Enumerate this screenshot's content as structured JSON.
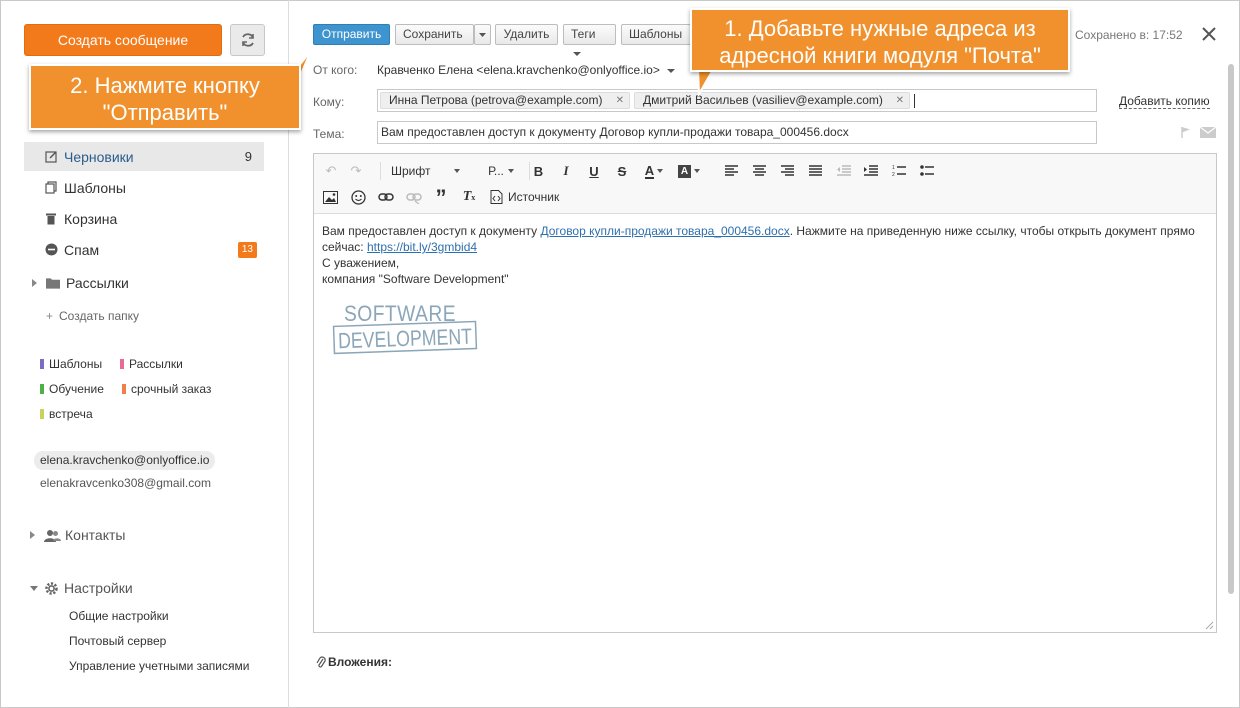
{
  "sidebar": {
    "create_label": "Создать сообщение",
    "folders": [
      {
        "label": "Черновики",
        "count": "9"
      },
      {
        "label": "Шаблоны"
      },
      {
        "label": "Корзина"
      },
      {
        "label": "Спам",
        "badge": "13"
      },
      {
        "label": "Рассылки"
      }
    ],
    "create_folder_label": "Создать папку",
    "tags": [
      {
        "label": "Шаблоны",
        "color": "#7b6cc4"
      },
      {
        "label": "Рассылки",
        "color": "#e96a90"
      },
      {
        "label": "Обучение",
        "color": "#4fb04a"
      },
      {
        "label": "срочный заказ",
        "color": "#f07f4a"
      },
      {
        "label": "встреча",
        "color": "#c9d35b"
      }
    ],
    "accounts": [
      "elena.kravchenko@onlyoffice.io",
      "elenakravcenko308@gmail.com"
    ],
    "contacts_label": "Контакты",
    "settings_label": "Настройки",
    "settings_items": [
      "Общие настройки",
      "Почтовый сервер",
      "Управление учетными записями"
    ]
  },
  "toolbar": {
    "send_label": "Отправить",
    "save_label": "Сохранить",
    "delete_label": "Удалить",
    "tags_label": "Теги",
    "templates_label": "Шаблоны",
    "saved_text": "Сохранено в: 17:52"
  },
  "compose": {
    "from_label": "От кого:",
    "from_value": "Кравченко Елена <elena.kravchenko@onlyoffice.io>",
    "to_label": "Кому:",
    "recipients": [
      "Инна Петрова (petrova@example.com)",
      "Дмитрий Васильев (vasiliev@example.com)"
    ],
    "add_copy_label": "Добавить копию",
    "subject_label": "Тема:",
    "subject_value": "Вам предоставлен доступ к документу Договор купли-продажи товара_000456.docx"
  },
  "editor": {
    "font_label": "Шрифт",
    "size_label": "Р...",
    "source_label": "Источник",
    "body_intro": "Вам предоставлен доступ к документу ",
    "body_link": "Договор купли-продажи товара_000456.docx",
    "body_after": ". Нажмите на приведенную ниже ссылку, чтобы открыть документ прямо сейчас: ",
    "body_url": "https://bit.ly/3gmbid4",
    "body_regards": "С уважением,",
    "body_company": "компания \"Software Development\"",
    "logo_top": "SOFTWARE",
    "logo_bottom": "DEVELOPMENT"
  },
  "attachments_label": "Вложения:",
  "callouts": {
    "step1": "1. Добавьте нужные адреса из адресной книги модуля \"Почта\"",
    "step2": "2. Нажмите кнопку \"Отправить\""
  }
}
